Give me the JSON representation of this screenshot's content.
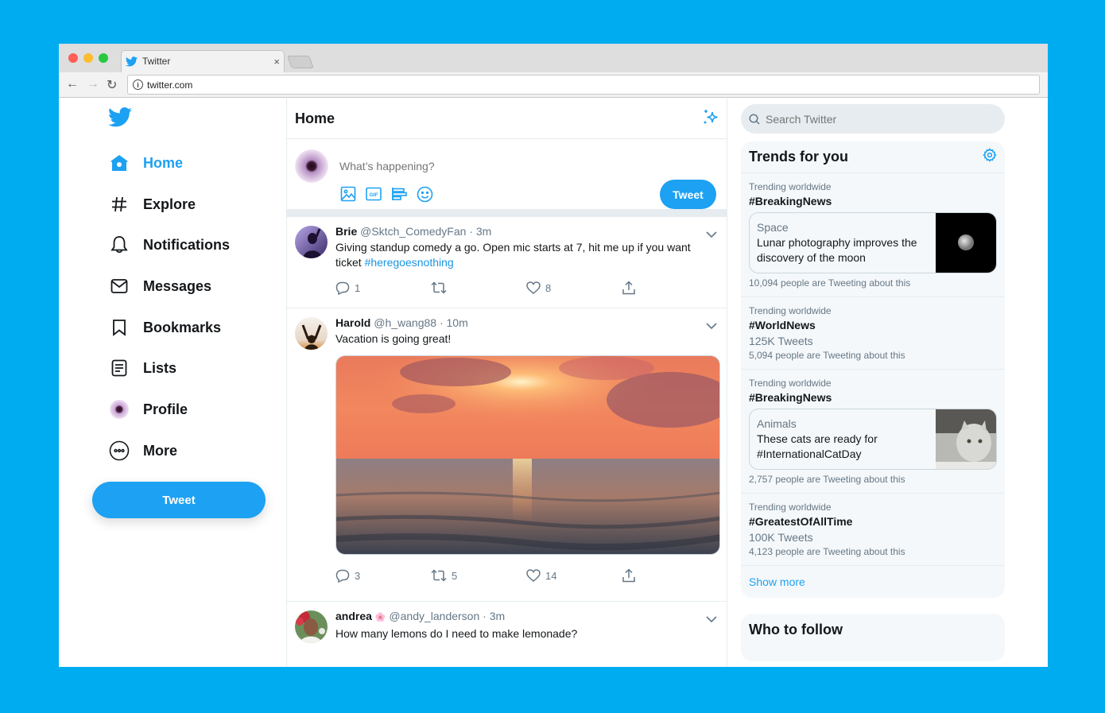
{
  "browser": {
    "tab_title": "Twitter",
    "tab_close": "×",
    "url": "twitter.com",
    "traffic_lights": {
      "close": "#ff5f57",
      "minimize": "#febc2e",
      "maximize": "#28c840"
    }
  },
  "theme": {
    "accent": "#1da1f2",
    "background": "#00acf0"
  },
  "sidebar": {
    "items": [
      {
        "label": "Home",
        "icon": "home-icon",
        "active": true
      },
      {
        "label": "Explore",
        "icon": "hashtag-icon"
      },
      {
        "label": "Notifications",
        "icon": "bell-icon"
      },
      {
        "label": "Messages",
        "icon": "envelope-icon"
      },
      {
        "label": "Bookmarks",
        "icon": "bookmark-icon"
      },
      {
        "label": "Lists",
        "icon": "list-icon"
      },
      {
        "label": "Profile",
        "icon": "profile-avatar"
      },
      {
        "label": "More",
        "icon": "more-icon"
      }
    ],
    "tweet_button": "Tweet"
  },
  "main": {
    "title": "Home",
    "composer": {
      "placeholder": "What’s happening?",
      "tweet_button": "Tweet"
    },
    "tweets": [
      {
        "name": "Brie",
        "handle": "@Sktch_ComedyFan",
        "time": "3m",
        "text": "Giving standup comedy a go. Open mic starts at 7, hit me up if you want ticket ",
        "hashtag": "#heregoesnothing",
        "replies": "1",
        "retweets": "",
        "likes": "8"
      },
      {
        "name": "Harold",
        "handle": "@h_wang88",
        "time": "10m",
        "text": "Vacation is going great!",
        "replies": "3",
        "retweets": "5",
        "likes": "14"
      },
      {
        "name": "andrea",
        "emoji": "🌸",
        "handle": "@andy_landerson",
        "time": "3m",
        "text": "How many lemons do I need to make lemonade?"
      }
    ]
  },
  "right": {
    "search_placeholder": "Search Twitter",
    "trends_title": "Trends for you",
    "trends": [
      {
        "context": "Trending worldwide",
        "tag": "#BreakingNews",
        "card": {
          "category": "Space",
          "headline": "Lunar photography improves the discovery of the moon"
        },
        "people": "10,094 people are Tweeting about this"
      },
      {
        "context": "Trending worldwide",
        "tag": "#WorldNews",
        "count": "125K Tweets",
        "people": "5,094 people are Tweeting about this"
      },
      {
        "context": "Trending worldwide",
        "tag": "#BreakingNews",
        "card": {
          "category": "Animals",
          "headline": "These cats are ready for #InternationalCatDay"
        },
        "people": "2,757 people are Tweeting about this"
      },
      {
        "context": "Trending worldwide",
        "tag": "#GreatestOfAllTime",
        "count": "100K Tweets",
        "people": "4,123 people are Tweeting about this"
      }
    ],
    "show_more": "Show more",
    "who_to_follow": "Who to follow"
  }
}
